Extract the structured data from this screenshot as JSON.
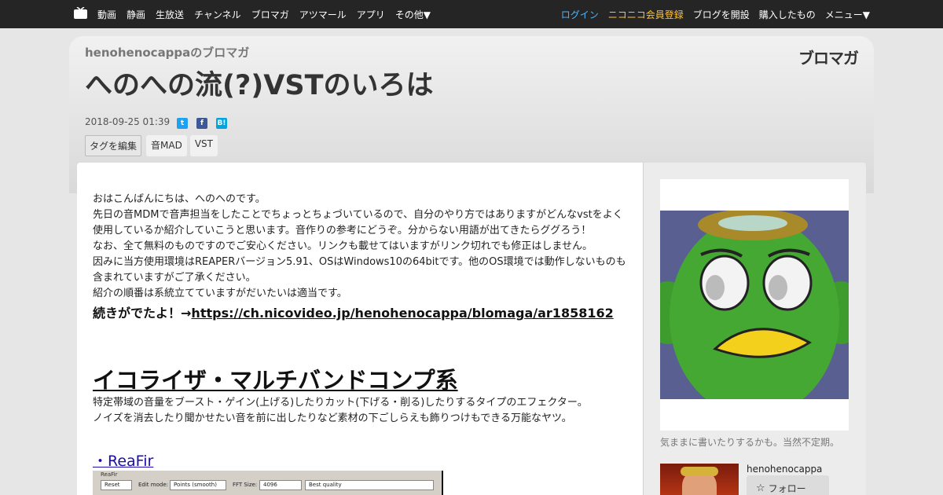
{
  "nav": {
    "left_items": [
      "動画",
      "静画",
      "生放送",
      "チャンネル",
      "ブロマガ",
      "アツマール",
      "アプリ",
      "その他▼"
    ],
    "login": "ログイン",
    "register": "ニコニコ会員登録",
    "open_blog": "ブログを開設",
    "purchased": "購入したもの",
    "menu": "メニュー▼"
  },
  "header": {
    "blog_name": "henohenocappaのブロマガ",
    "brand": "ブロマガ",
    "title": "へのへの流(?)VSTのいろは",
    "date": "2018-09-25 01:39",
    "share": [
      "t",
      "f",
      "B!"
    ],
    "tag_edit": "タグを編集",
    "tags": [
      "音MAD",
      "VST"
    ]
  },
  "article": {
    "paragraphs": [
      "おはこんばんにちは、へのへのです。",
      "先日の音MDMで音声担当をしたことでちょっとちょづいているので、自分のやり方ではありますがどんなvstをよく使用しているか紹介していこうと思います。音作りの参考にどうぞ。分からない用語が出てきたらググろう！",
      "なお、全て無料のものですのでご安心ください。リンクも載せてはいますがリンク切れでも修正はしません。",
      "因みに当方使用環境はREAPERバージョン5.91、OSはWindows10の64bitです。他のOS環境では動作しないものも含まれていますがご了承ください。",
      "紹介の順番は系統立てていますがだいたいは適当です。"
    ],
    "more_prefix": "続きがでたよ！→",
    "more_link": "https://ch.nicovideo.jp/henohenocappa/blomaga/ar1858162",
    "section_heading": "イコライザ・マルチバンドコンプ系",
    "section_paragraphs": [
      "特定帯域の音量をブースト・ゲイン(上げる)したりカット(下げる・削る)したりするタイプのエフェクター。",
      "ノイズを消去したり聞かせたい音を前に出したりなど素材の下ごしらえも飾りつけもできる万能なヤツ。"
    ],
    "plugin_link": "・ReaFir",
    "plugin": {
      "title": "ReaFir",
      "reset": "Reset",
      "edit_mode_label": "Edit mode:",
      "edit_mode_value": "Points (smooth)",
      "fft_label": "FFT Size:",
      "fft_value": "4096",
      "quality_value": "Best quality"
    }
  },
  "sidebar": {
    "description": "気ままに書いたりするかも。当然不定期。",
    "author": "henohenocappa",
    "follow": "フォロー"
  }
}
